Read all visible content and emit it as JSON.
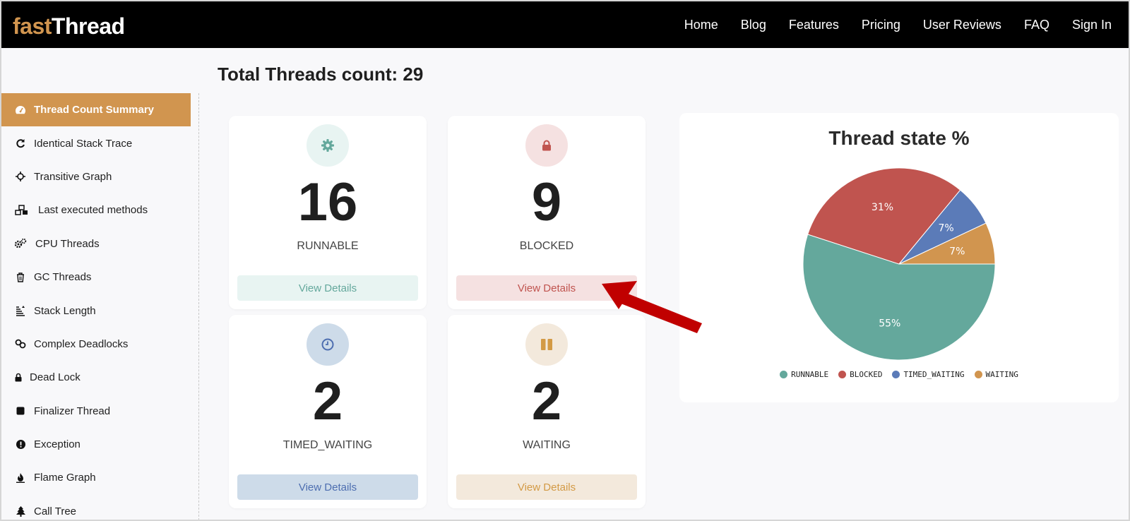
{
  "brand": {
    "part1": "fast",
    "part2": "Thread"
  },
  "nav": [
    "Home",
    "Blog",
    "Features",
    "Pricing",
    "User Reviews",
    "FAQ",
    "Sign In"
  ],
  "page_title": "Total Threads count: 29",
  "sidebar": {
    "items": [
      {
        "label": "Thread Count Summary",
        "icon": "dashboard-icon",
        "active": true
      },
      {
        "label": "Identical Stack Trace",
        "icon": "refresh-icon"
      },
      {
        "label": "Transitive Graph",
        "icon": "crosshair-icon"
      },
      {
        "label": "Last executed methods",
        "icon": "cubes-icon"
      },
      {
        "label": "CPU Threads",
        "icon": "gears-icon"
      },
      {
        "label": "GC Threads",
        "icon": "trash-icon"
      },
      {
        "label": "Stack Length",
        "icon": "stack-icon"
      },
      {
        "label": "Complex Deadlocks",
        "icon": "link-icon"
      },
      {
        "label": "Dead Lock",
        "icon": "lock-icon"
      },
      {
        "label": "Finalizer Thread",
        "icon": "square-icon"
      },
      {
        "label": "Exception",
        "icon": "exclamation-icon"
      },
      {
        "label": "Flame Graph",
        "icon": "fire-icon"
      },
      {
        "label": "Call Tree",
        "icon": "tree-icon"
      }
    ]
  },
  "cards": [
    {
      "count": "16",
      "state": "RUNNABLE",
      "button": "View Details",
      "icon": "gear-icon",
      "color": "#64a89c",
      "tint": "#e8f4f2"
    },
    {
      "count": "9",
      "state": "BLOCKED",
      "button": "View Details",
      "icon": "lock-icon",
      "color": "#c0544f",
      "tint": "#f5e1e1"
    },
    {
      "count": "2",
      "state": "TIMED_WAITING",
      "button": "View Details",
      "icon": "clock-icon",
      "color": "#4d6eb0",
      "tint": "#cddbe9"
    },
    {
      "count": "2",
      "state": "WAITING",
      "button": "View Details",
      "icon": "pause-icon",
      "color": "#d39a45",
      "tint": "#f3e9dc"
    }
  ],
  "chart_data": {
    "type": "pie",
    "title": "Thread state %",
    "categories": [
      "RUNNABLE",
      "BLOCKED",
      "TIMED_WAITING",
      "WAITING"
    ],
    "values": [
      55,
      31,
      7,
      7
    ],
    "labels": [
      "55%",
      "31%",
      "7%",
      "7%"
    ],
    "colors": [
      "#64a89c",
      "#c0544f",
      "#5b7bb8",
      "#d1954f"
    ],
    "legend": "bottom"
  },
  "annotation": {
    "arrow_color": "#c00000",
    "arrow_icon": "arrow-icon"
  }
}
